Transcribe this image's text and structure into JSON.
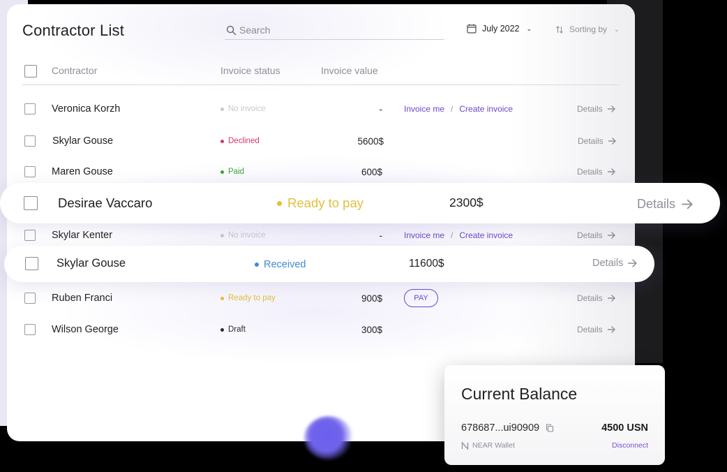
{
  "header": {
    "title": "Contractor List",
    "search_placeholder": "Search",
    "date_filter": "July 2022",
    "sort_label": "Sorting by"
  },
  "columns": {
    "contractor": "Contractor",
    "invoice_status": "Invoice status",
    "invoice_value": "Invoice value"
  },
  "rows": [
    {
      "name": "Veronica Korzh",
      "status": "No invoice",
      "value": "-",
      "invoice_me": "Invoice me",
      "separator": "/",
      "create_invoice": "Create invoice",
      "details": "Details"
    },
    {
      "name": "Skylar Gouse",
      "status": "Declined",
      "value": "5600$",
      "details": "Details"
    },
    {
      "name": "Maren Gouse",
      "status": "Paid",
      "value": "600$",
      "details": "Details"
    },
    {
      "name": "Desirae Vaccaro",
      "status": "Ready to pay",
      "value": "2300$",
      "details": "Details"
    },
    {
      "name": "Skylar Kenter",
      "status": "No invoice",
      "value": "-",
      "invoice_me": "Invoice me",
      "separator": "/",
      "create_invoice": "Create invoice",
      "details": "Details"
    },
    {
      "name": "Skylar Gouse",
      "status": "Received",
      "value": "11600$",
      "details": "Details"
    },
    {
      "name": "Ruben Franci",
      "status": "Ready to pay",
      "value": "900$",
      "pay_button": "PAY",
      "details": "Details"
    },
    {
      "name": "Wilson George",
      "status": "Draft",
      "value": "300$",
      "details": "Details"
    }
  ],
  "status_colors": {
    "no_invoice": "#c9c7cf",
    "declined": "#d63567",
    "paid": "#3aa636",
    "ready_to_pay": "#e2bf3d",
    "received": "#3e8bd1",
    "draft": "#2b2b2f",
    "accent": "#6d47c9"
  },
  "balance": {
    "title": "Current Balance",
    "address": "678687...ui90909",
    "amount": "4500 USN",
    "wallet": "NEAR Wallet",
    "disconnect": "Disconnect"
  }
}
